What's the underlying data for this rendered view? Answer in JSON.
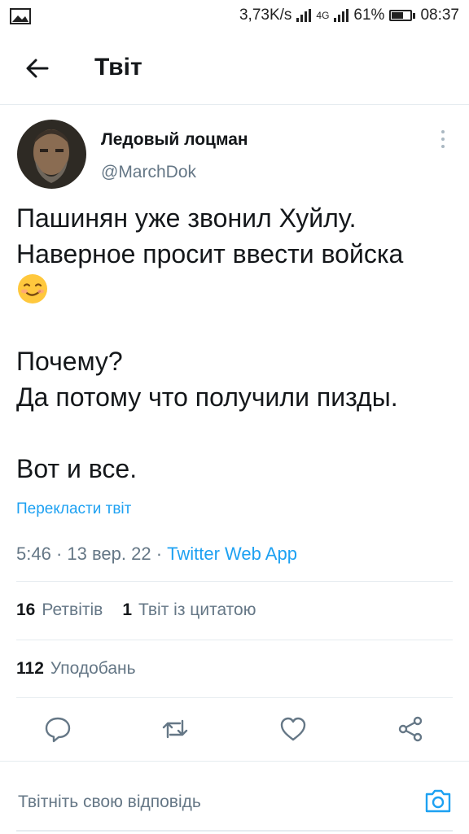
{
  "status_bar": {
    "speed": "3,73K/s",
    "network": "4G",
    "battery": "61%",
    "battery_level": 0.61,
    "time": "08:37"
  },
  "header": {
    "title": "Твіт",
    "back_icon": "arrow-left-icon"
  },
  "author": {
    "name": "Ледовый лоцман",
    "handle": "@MarchDok"
  },
  "tweet": {
    "line1": "Пашинян уже звонил Хуйлу.",
    "line2": "Наверное просит ввести войска",
    "emoji": "smiling-face-emoji",
    "line3": "Почему?",
    "line4": "Да потому что получили пизды.",
    "line5": "Вот и все."
  },
  "translate_label": "Перекласти твіт",
  "meta": {
    "time": "5:46",
    "sep": " · ",
    "date": "13 вер. 22",
    "source": "Twitter Web App"
  },
  "stats": {
    "retweets_count": "16",
    "retweets_label": "Ретвітів",
    "quotes_count": "1",
    "quotes_label": "Твіт із цитатою",
    "likes_count": "112",
    "likes_label": "Уподобань"
  },
  "actions": [
    "reply-icon",
    "retweet-icon",
    "like-icon",
    "share-icon"
  ],
  "reply": {
    "placeholder": "Твітніть свою відповідь",
    "camera_icon": "camera-icon"
  },
  "colors": {
    "accent": "#1da1f2",
    "text": "#14171a",
    "secondary": "#657786",
    "divider": "#e6ecf0"
  }
}
